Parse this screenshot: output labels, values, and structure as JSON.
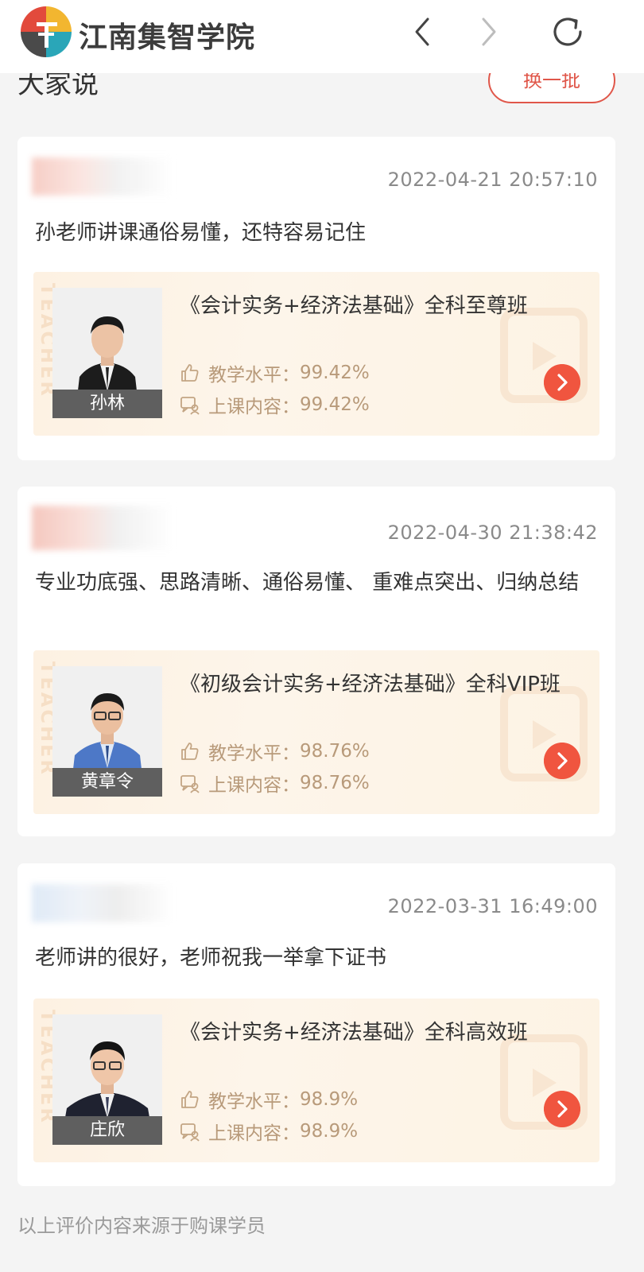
{
  "header": {
    "app_title": "江南集智学院",
    "logo_icon": "jiangnan-logo-icon",
    "back_icon": "chevron-left-icon",
    "forward_icon": "chevron-right-icon",
    "refresh_icon": "refresh-icon"
  },
  "section": {
    "title": "大家说",
    "refresh_button": "换一批"
  },
  "reviews": [
    {
      "time": "2022-04-21 20:57:10",
      "text": "孙老师讲课通俗易懂，还特容易记住",
      "course": {
        "teacher_name": "孙林",
        "title": "《会计实务+经济法基础》全科至尊班",
        "teaching_label": "教学水平：",
        "teaching_value": "99.42%",
        "content_label": "上课内容：",
        "content_value": "99.42%"
      }
    },
    {
      "time": "2022-04-30 21:38:42",
      "text": "专业功底强、思路清晰、通俗易懂、 重难点突出、归纳总结",
      "course": {
        "teacher_name": "黄章令",
        "title": "《初级会计实务+经济法基础》全科VIP班",
        "teaching_label": "教学水平：",
        "teaching_value": "98.76%",
        "content_label": "上课内容：",
        "content_value": "98.76%"
      }
    },
    {
      "time": "2022-03-31 16:49:00",
      "text": "老师讲的很好，老师祝我一举拿下证书",
      "course": {
        "teacher_name": "庄欣",
        "title": "《会计实务+经济法基础》全科高效班",
        "teaching_label": "教学水平：",
        "teaching_value": "98.9%",
        "content_label": "上课内容：",
        "content_value": "98.9%"
      }
    }
  ],
  "watermark": "TEACHER",
  "footer_note": "以上评价内容来源于购课学员",
  "colors": {
    "accent": "#f0553f",
    "button_border": "#e0574a",
    "metric_text": "#b89a7a",
    "course_bg": "#fdf1e2"
  }
}
